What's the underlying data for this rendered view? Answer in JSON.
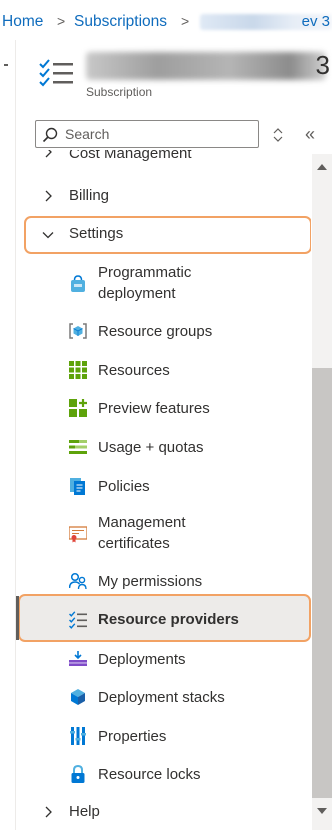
{
  "breadcrumb": {
    "items": [
      "Home",
      "Subscriptions"
    ],
    "tail": "ev 3"
  },
  "header": {
    "title_tail": "3",
    "subtitle": "Subscription"
  },
  "search": {
    "placeholder": "Search"
  },
  "controls": {
    "collapse": "«"
  },
  "nav": {
    "partial_top_label": "Cost Management",
    "groups": [
      {
        "label": "Billing"
      },
      {
        "label": "Settings"
      },
      {
        "label": "Help"
      }
    ],
    "settings_items": [
      {
        "label": "Programmatic deployment",
        "icon": "bag-icon"
      },
      {
        "label": "Resource groups",
        "icon": "resource-groups-icon"
      },
      {
        "label": "Resources",
        "icon": "grid-icon"
      },
      {
        "label": "Preview features",
        "icon": "preview-features-icon"
      },
      {
        "label": "Usage + quotas",
        "icon": "usage-quotas-icon"
      },
      {
        "label": "Policies",
        "icon": "policies-icon"
      },
      {
        "label": "Management certificates",
        "icon": "certificate-icon"
      },
      {
        "label": "My permissions",
        "icon": "people-icon"
      },
      {
        "label": "Resource providers",
        "icon": "list-check-icon"
      },
      {
        "label": "Deployments",
        "icon": "deployments-icon"
      },
      {
        "label": "Deployment stacks",
        "icon": "cube-icon"
      },
      {
        "label": "Properties",
        "icon": "properties-icon"
      },
      {
        "label": "Resource locks",
        "icon": "lock-icon"
      }
    ]
  },
  "colors": {
    "link": "#0f6cbd",
    "highlight_outline": "#f2a264",
    "selected_bg": "#edebe9"
  }
}
